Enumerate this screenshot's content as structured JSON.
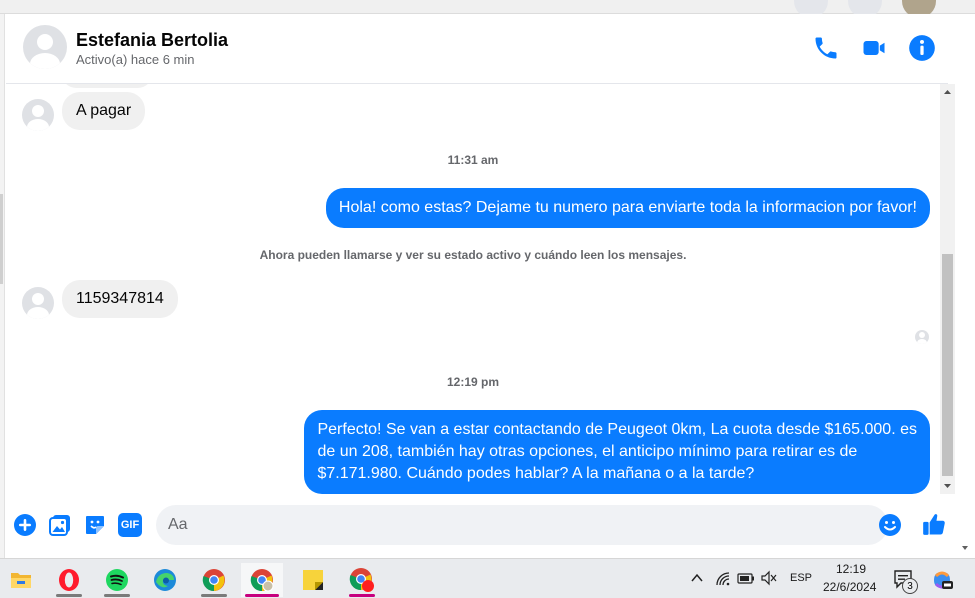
{
  "header": {
    "contact_name": "Estefania Bertolia",
    "contact_status": "Activo(a) hace 6 min",
    "icons": [
      "phone-icon",
      "video-camera-icon",
      "info-icon"
    ],
    "accent_color": "#0a7cff"
  },
  "messages": [
    {
      "direction": "in",
      "text": "A pagar"
    },
    {
      "type": "timestamp",
      "text": "11:31 am"
    },
    {
      "direction": "out",
      "text": "Hola! como estas? Dejame tu numero para enviarte toda la informacion por favor!"
    },
    {
      "type": "system",
      "text": "Ahora pueden llamarse y ver su estado activo y cuándo leen los mensajes."
    },
    {
      "direction": "in",
      "text": "1159347814"
    },
    {
      "type": "timestamp",
      "text": "12:19 pm"
    },
    {
      "direction": "out",
      "lines": [
        "Perfecto!  Se van a estar contactando de Peugeot 0km, La cuota desde $165.000. es",
        "de un 208, también hay otras opciones, el anticipo mínimo para retirar es de",
        "$7.171.980. Cuándo podes hablar? A la mañana o a la tarde?"
      ]
    }
  ],
  "composer": {
    "placeholder": "Aa",
    "gif_label": "GIF",
    "icons": [
      "plus-circle-icon",
      "image-icon",
      "sticker-icon",
      "gif-icon",
      "emoji-icon",
      "thumbs-up-icon"
    ]
  },
  "taskbar": {
    "apps": [
      "file-explorer-icon",
      "opera-icon",
      "spotify-icon",
      "edge-icon",
      "chrome-icon",
      "chrome-profile-icon",
      "sticky-notes-icon",
      "chrome-red-profile-icon"
    ],
    "tray": {
      "language": "ESP",
      "time": "12:19",
      "date": "22/6/2024",
      "notification_count": "3"
    }
  }
}
